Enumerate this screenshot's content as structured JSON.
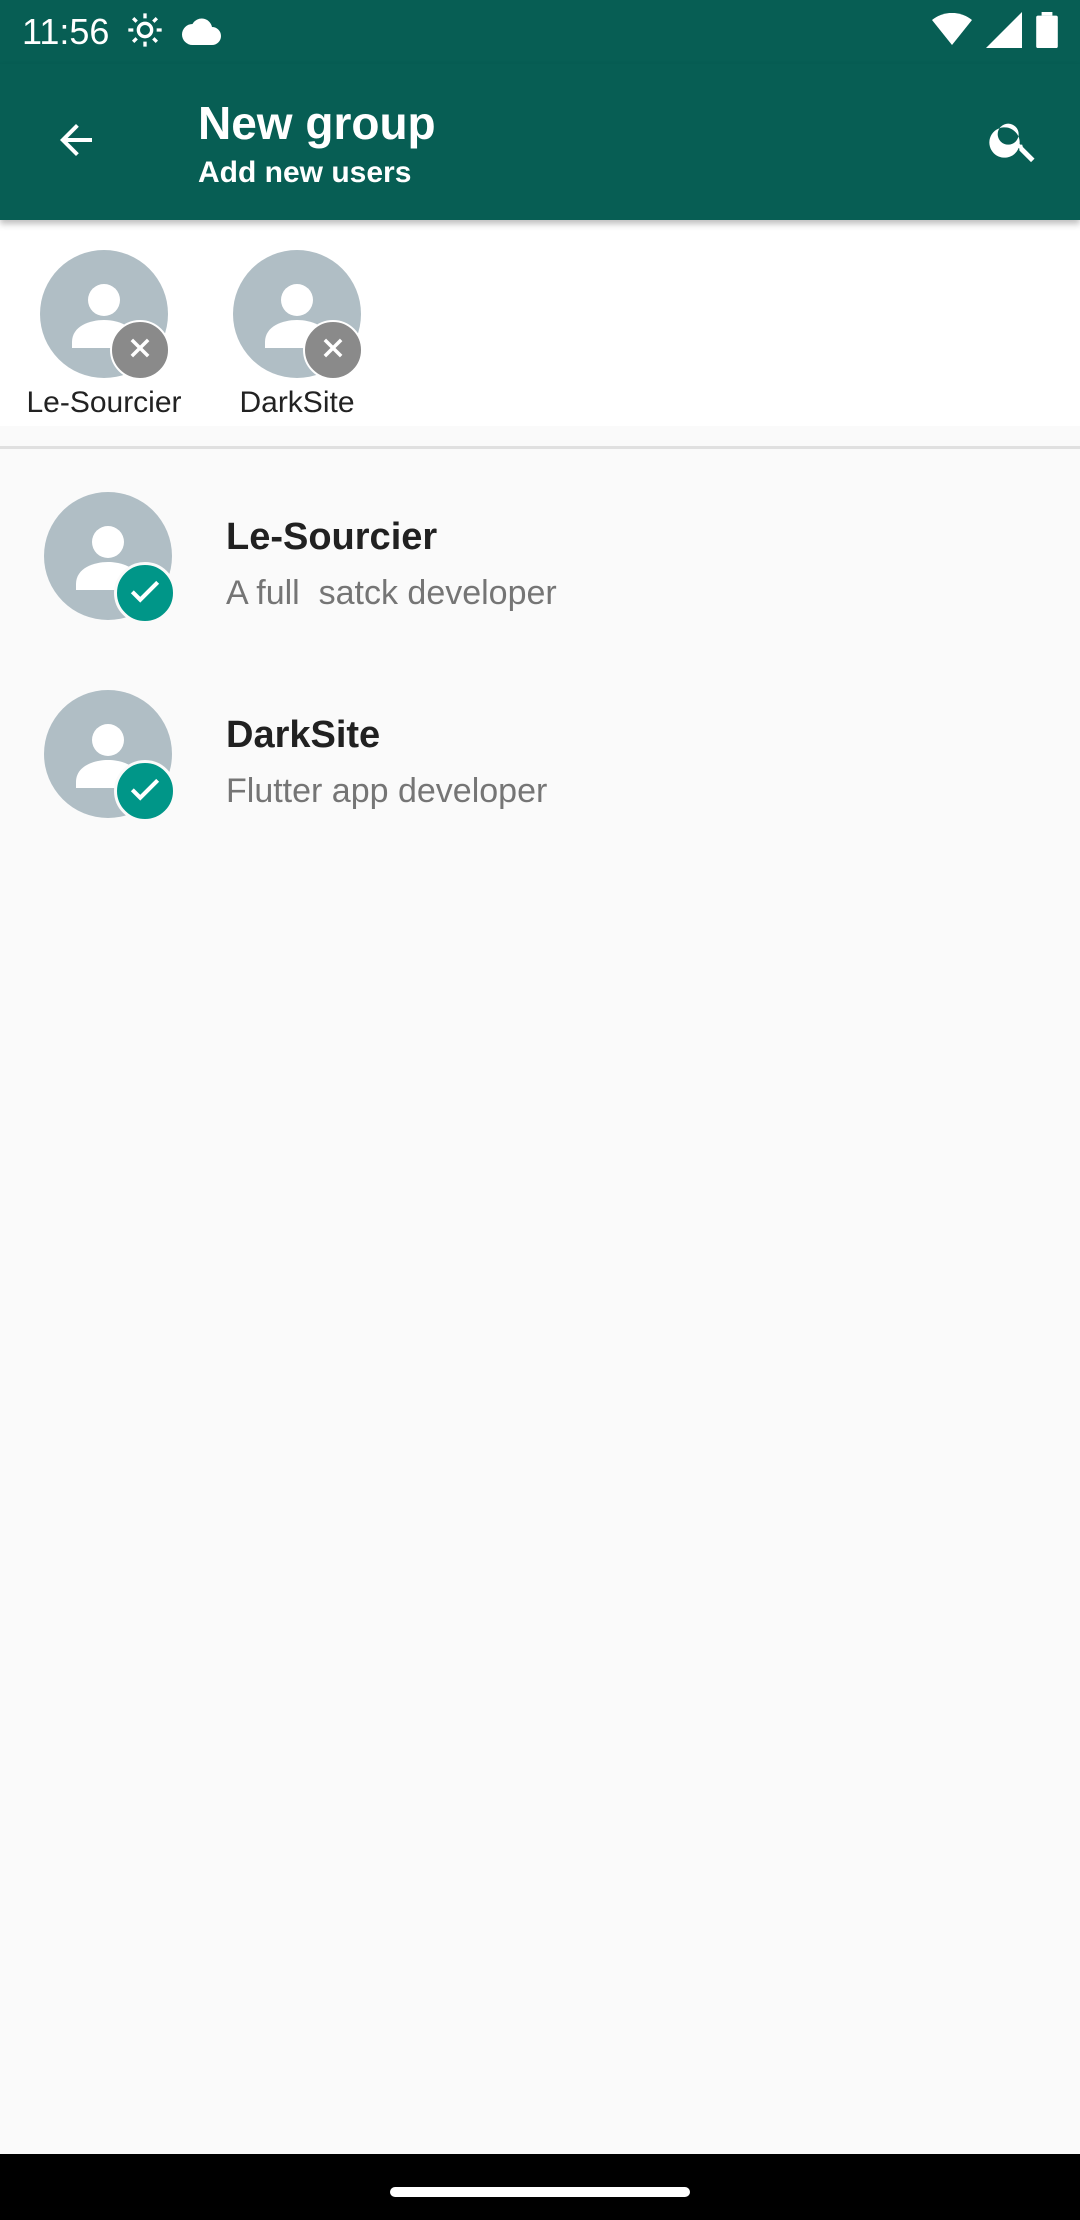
{
  "status_bar": {
    "time": "11:56",
    "icons": [
      "settings-icon",
      "cloud-icon",
      "wifi-icon",
      "signal-icon",
      "battery-icon"
    ]
  },
  "app_bar": {
    "title": "New group",
    "subtitle": "Add new users",
    "back_icon": "arrow-back-icon",
    "search_icon": "search-icon",
    "background_color": "#075e54"
  },
  "selected": [
    {
      "name": "Le-Sourcier"
    },
    {
      "name": "DarkSite"
    }
  ],
  "contacts": [
    {
      "name": "Le-Sourcier",
      "about": "A full  satck developer",
      "selected": true
    },
    {
      "name": "DarkSite",
      "about": "Flutter app developer",
      "selected": true
    }
  ],
  "colors": {
    "primary": "#075e54",
    "accent": "#009688",
    "avatar": "#b0bec5"
  }
}
